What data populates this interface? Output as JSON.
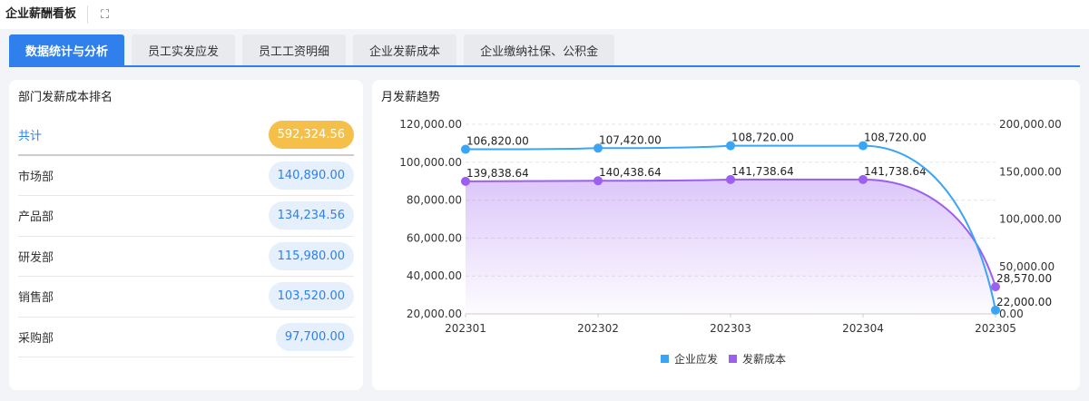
{
  "header": {
    "title": "企业薪酬看板",
    "expand_icon": "expand-icon"
  },
  "tabs": [
    {
      "label": "数据统计与分析"
    },
    {
      "label": "员工实发应发"
    },
    {
      "label": "员工工资明细"
    },
    {
      "label": "企业发薪成本"
    },
    {
      "label": "企业缴纳社保、公积金"
    }
  ],
  "ranking": {
    "title": "部门发薪成本排名",
    "total_label": "共计",
    "total_value": "592,324.56",
    "rows": [
      {
        "name": "市场部",
        "value": "140,890.00"
      },
      {
        "name": "产品部",
        "value": "134,234.56"
      },
      {
        "name": "研发部",
        "value": "115,980.00"
      },
      {
        "name": "销售部",
        "value": "103,520.00"
      },
      {
        "name": "采购部",
        "value": "97,700.00"
      }
    ]
  },
  "trend": {
    "title": "月发薪趋势"
  },
  "chart_data": {
    "type": "line",
    "categories": [
      "202301",
      "202302",
      "202303",
      "202304",
      "202305"
    ],
    "series": [
      {
        "name": "企业应发",
        "axis": "left",
        "color": "#3aa5f5",
        "values": [
          106820,
          107420,
          108720,
          108720,
          22000
        ],
        "labels": [
          "106,820.00",
          "107,420.00",
          "108,720.00",
          "108,720.00",
          "22,000.00"
        ]
      },
      {
        "name": "发薪成本",
        "axis": "right",
        "color": "#9c5ff0",
        "area": true,
        "values": [
          139838.64,
          140438.64,
          141738.64,
          141738.64,
          28570
        ],
        "labels": [
          "139,838.64",
          "140,438.64",
          "141,738.64",
          "141,738.64",
          "28,570.00"
        ]
      }
    ],
    "left_axis": {
      "min": 20000,
      "max": 120000,
      "ticks": [
        "20,000.00",
        "40,000.00",
        "60,000.00",
        "80,000.00",
        "100,000.00",
        "120,000.00"
      ]
    },
    "right_axis": {
      "min": 0,
      "max": 200000,
      "ticks": [
        "0.00",
        "50,000.00",
        "100,000.00",
        "150,000.00",
        "200,000.00"
      ]
    },
    "legend": "bottom-center"
  }
}
